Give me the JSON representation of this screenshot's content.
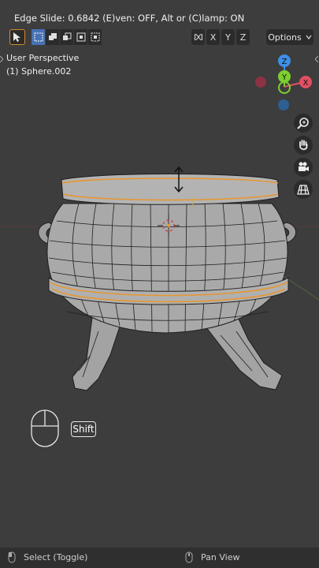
{
  "header": {
    "operator_text": "Edge Slide: 0.6842 (E)ven: OFF, Alt or (C)lamp: ON"
  },
  "toolbar": {
    "select_tool_icon": "cursor-arrow-icon",
    "select_modes": [
      "select-new",
      "select-extend",
      "select-subtract",
      "select-invert",
      "select-intersect"
    ],
    "active_mode": "select-new",
    "mirror_icon": "butterfly-icon",
    "axes": [
      "X",
      "Y",
      "Z"
    ],
    "options_label": "Options",
    "accent_color": "#4772b3"
  },
  "viewport": {
    "view_name": "User Perspective",
    "object_name": "(1) Sphere.002",
    "highlight_color": "#e8962e"
  },
  "gizmo": {
    "z_label": "Z",
    "y_label": "Y",
    "x_label": "X",
    "x_color": "#e04f63",
    "y_color": "#7ccf2e",
    "z_color": "#3e8fe6"
  },
  "nav_buttons": [
    "zoom-icon",
    "pan-hand-icon",
    "camera-icon",
    "grid-ortho-icon"
  ],
  "hint": {
    "key_label": "Shift",
    "mouse_icon": "mouse-icon"
  },
  "status_bar": {
    "left_action": "Select (Toggle)",
    "right_action": "Pan View"
  }
}
